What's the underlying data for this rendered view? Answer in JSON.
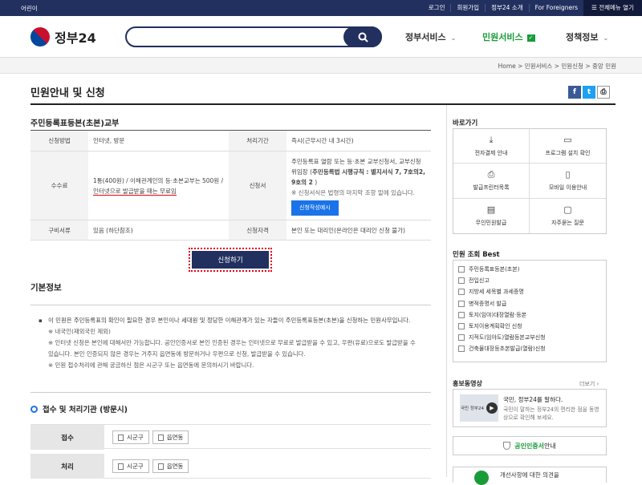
{
  "topbar": {
    "left_link": "어린이",
    "links": [
      "로그인",
      "회원가입",
      "정부24 소개",
      "For Foreigners"
    ],
    "menu_open": "☰ 전체메뉴 열기"
  },
  "header": {
    "logo_text": "정부24",
    "search_placeholder": "",
    "gnb": [
      {
        "label": "정부서비스",
        "arrow": "⌄"
      },
      {
        "label": "민원서비스",
        "arrow": "✓"
      },
      {
        "label": "정책정보",
        "arrow": "⌄"
      }
    ]
  },
  "breadcrumb": "Home  >  민원서비스  >  민원신청  >  중앙 민원",
  "page": {
    "title": "민원안내 및 신청",
    "share": [
      "f",
      "t",
      "⎙"
    ]
  },
  "service": {
    "title": "주민등록표등본(초본)교부",
    "rows": {
      "method_label": "신청방법",
      "method_value": "인터넷, 방문",
      "period_label": "처리기간",
      "period_value": "즉시(근무시간 내 3시간)",
      "fee_label": "수수료",
      "fee_value_1": "1통(400원) / 이해관계인의 등·초본교부는 500원 / ",
      "fee_value_2": "인터넷으로 발급받을 때는 무료임",
      "form_label": "신청서",
      "form_value_1": "주민등록표 열람 또는 등·초본 교부신청서, 교부신청 위임장 (",
      "form_value_bold": "주민등록법 시행규칙 : 별지서식 7, 7호의2, 9호의 2",
      "form_value_2": " )",
      "form_note": "※ 신청서식은 법령의 마지막 조항 밑에 있습니다.",
      "form_button": "신청작성예시",
      "docs_label": "구비서류",
      "docs_value": "있음 (하단참조)",
      "qual_label": "신청자격",
      "qual_value": "본인 또는 대리인(온라인은 대리인 신청 불가)"
    },
    "apply_button": "신청하기"
  },
  "basic": {
    "title": "기본정보",
    "para": "이 민원은 주민등록표의 확인이 필요한 경우 본인이나 세대원 및 정당한 이해관계가 있는 자들이 주민등록표등본(초본)을 신청하는 민원사무입니다.",
    "notes": [
      "※ 내국인(재외국민 제외)",
      "※ 인터넷 신청은 본인에 대해서만 가능합니다. 공인인증서로 본인 인증된 경우는 인터넷으로 무료로 발급받을 수 있고, 우편(유료)으로도 발급받을 수 있습니다. 본인 인증되지 않은 경우는 거주지 읍면동에 방문하거나 우편으로 신청, 발급받을 수 있습니다.",
      "※ 민원 접수처리에 관해 궁금하신 점은 시군구 또는 읍면동에 문의하시기 바랍니다."
    ]
  },
  "process": {
    "title": "접수 및 처리기관 (방문시)",
    "rows": [
      {
        "label": "접수",
        "chips": [
          "시군구",
          "읍면동"
        ]
      },
      {
        "label": "처리",
        "chips": [
          "시군구",
          "읍면동"
        ]
      }
    ]
  },
  "sidebar": {
    "quick_title": "바로가기",
    "quick": [
      {
        "label": "전자결제 안내",
        "icon": "download-icon"
      },
      {
        "label": "프로그램 설치 확인",
        "icon": "monitor-icon"
      },
      {
        "label": "발급프린터목록",
        "icon": "printer-icon"
      },
      {
        "label": "모바일 이용안내",
        "icon": "mobile-icon"
      },
      {
        "label": "무인민원발급",
        "icon": "kiosk-icon"
      },
      {
        "label": "자주묻는 질문",
        "icon": "faq-icon"
      }
    ],
    "best_title": "민원 조회 Best",
    "best": [
      "주민등록표등본(초본)",
      "전입신고",
      "지방세 세목별 과세증명",
      "병적증명서 발급",
      "토지(임야)대장열람·등본",
      "토지이용계획확인 신청",
      "지적도(임야도)열람등본교부신청",
      "건축물대장등초본발급(열람)신청"
    ],
    "promo_title": "홍보동영상",
    "promo_more": "더보기 ›",
    "promo_t1": "국민, 정부24를 말하다.",
    "promo_t2": "국민이 말하는 정부24의 편리한 점을 동영상으로 확인해 보세요.",
    "promo_thumb": "국민 정부24",
    "cert_green": "공인인증서",
    "cert_rest": " 안내",
    "feedback": "개선사항에 대한 의견을"
  }
}
